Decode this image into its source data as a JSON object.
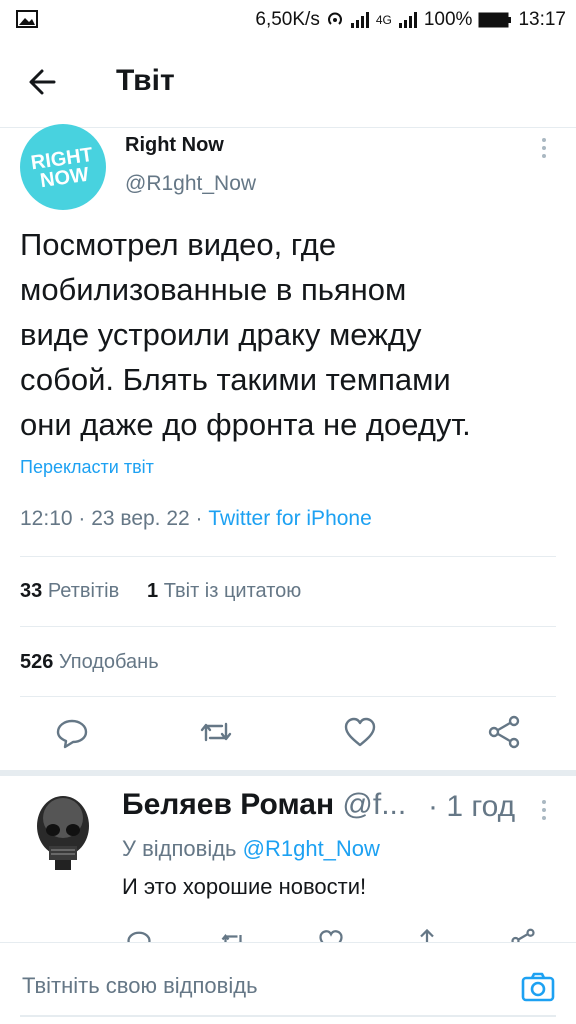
{
  "status_bar": {
    "speed": "6,50K/s",
    "network": "4G",
    "battery": "100%",
    "time": "13:17"
  },
  "header": {
    "title": "Твіт"
  },
  "tweet": {
    "author_name": "Right Now",
    "author_handle": "@R1ght_Now",
    "avatar_text_line1": "RIGHT",
    "avatar_text_line2": "NOW",
    "text": "Посмотрел видео, где\nмобилизованные в пьяном\nвиде устроили драку между\nсобой. Блять такими темпами\nони даже до фронта не доедут.",
    "translate_label": "Перекласти твіт",
    "timestamp": "12:10 · 23 вер. 22 · ",
    "source": "Twitter for iPhone",
    "retweets_count": "33",
    "retweets_label": "Ретвітів",
    "quotes_count": "1",
    "quotes_label": "Твіт із цитатою",
    "likes_count": "526",
    "likes_label": "Уподобань"
  },
  "reply": {
    "author_name": "Беляев Роман",
    "author_handle": "@f...",
    "time": "· 1 год",
    "replying_to_label": "У відповідь ",
    "replying_to_handle": "@R1ght_Now",
    "text": "И это хорошие новости!"
  },
  "compose": {
    "placeholder": "Твітніть свою відповідь"
  },
  "colors": {
    "accent": "#1da1f2",
    "secondary_text": "#657786",
    "avatar_bg": "#48d2df"
  },
  "icons": {
    "back": "arrow-left-icon",
    "more": "more-vertical-icon",
    "reply": "comment-icon",
    "retweet": "retweet-icon",
    "like": "heart-icon",
    "share": "share-icon",
    "camera": "camera-icon"
  }
}
